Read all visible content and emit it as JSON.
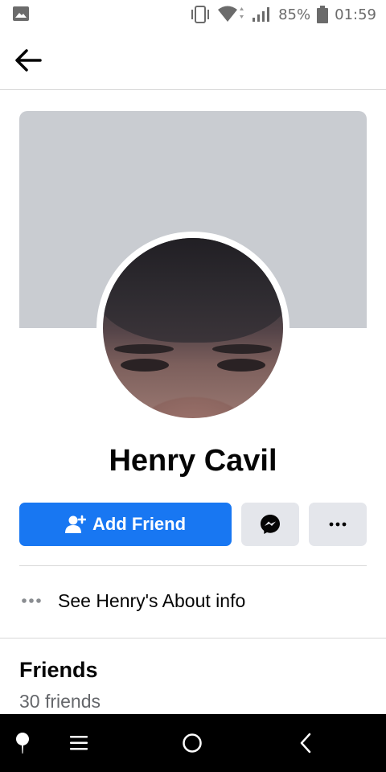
{
  "status_bar": {
    "battery_percent": "85%",
    "time": "01:59",
    "icons": [
      "gallery-icon",
      "vibrate-icon",
      "wifi-icon",
      "signal-icon",
      "battery-icon"
    ]
  },
  "app_bar": {
    "back_icon": "arrow-left-icon"
  },
  "profile": {
    "name": "Henry Cavil",
    "cover_color": "#c9ccd1"
  },
  "actions": {
    "add_friend_label": "Add Friend",
    "add_friend_icon": "add-person-icon",
    "message_icon": "messenger-icon",
    "more_icon": "more-horizontal-icon",
    "primary_color": "#1877f2"
  },
  "about": {
    "label": "See Henry's About info",
    "icon": "more-horizontal-icon"
  },
  "friends": {
    "title": "Friends",
    "count_text": "30 friends"
  },
  "nav_bar": {
    "icons": [
      "assistant-icon",
      "menu-icon",
      "home-circle-icon",
      "back-chevron-icon"
    ]
  }
}
